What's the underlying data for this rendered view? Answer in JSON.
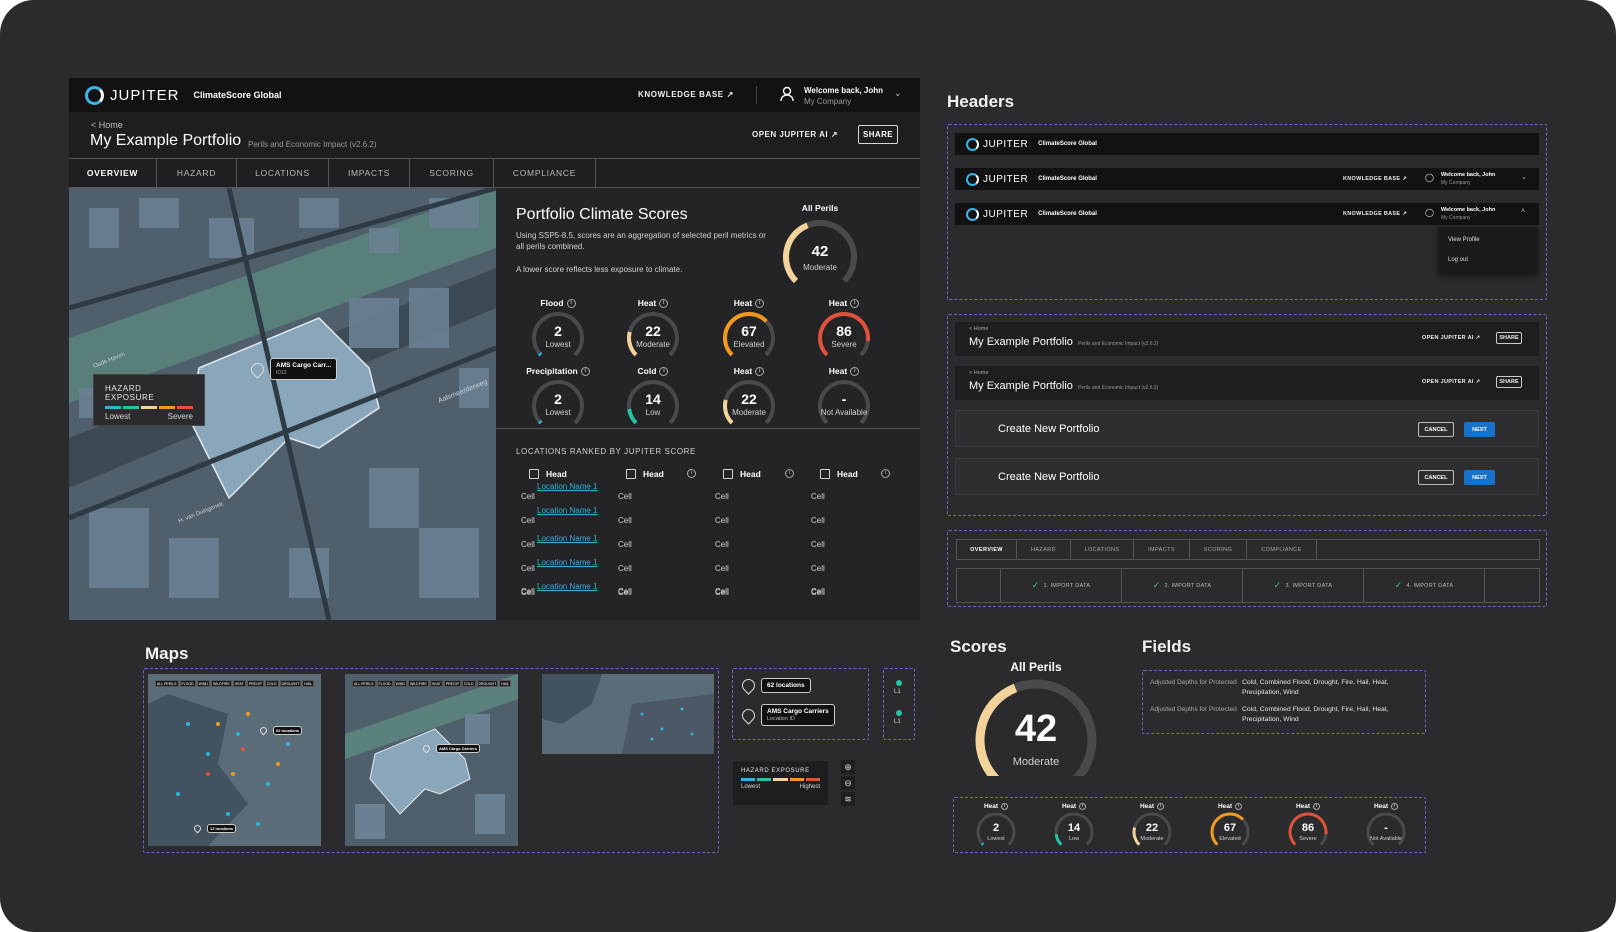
{
  "app": {
    "brand": "JUPITER",
    "product": "ClimateScore Global"
  },
  "header": {
    "knowledge_base": "KNOWLEDGE BASE",
    "welcome": "Welcome back, John",
    "company": "My Company"
  },
  "page": {
    "breadcrumb": "< Home",
    "title": "My Example Portfolio",
    "subtitle": "Perils and Economic Impact (v2.6.2)",
    "open_ai": "OPEN JUPITER AI",
    "share": "SHARE"
  },
  "tabs": [
    "OVERVIEW",
    "HAZARD",
    "LOCATIONS",
    "IMPACTS",
    "SCORING",
    "COMPLIANCE"
  ],
  "map": {
    "pin_label": "AMS Cargo Carr...",
    "pin_sub": "ID12",
    "legend_title": "HAZARD EXPOSURE",
    "legend_low": "Lowest",
    "legend_high": "Severe",
    "street1": "Aalsmeerderweg",
    "street2": "H. van Duingenstr.",
    "street3": "Oude Haven"
  },
  "portfolio": {
    "title": "Portfolio Climate Scores",
    "desc": "Using SSP5-8.5, scores are an aggregation of selected peril metrics or all perils combined.",
    "desc2": "A lower score reflects less exposure to climate.",
    "all_perils": {
      "peril": "All Perils",
      "value": "42",
      "label": "Moderate",
      "score": 42
    },
    "gauges": [
      {
        "peril": "Flood",
        "value": "2",
        "label": "Lowest",
        "score": 2,
        "color": "#2bb5d8"
      },
      {
        "peril": "Heat",
        "value": "22",
        "label": "Moderate",
        "score": 22,
        "color": "#f3d39a"
      },
      {
        "peril": "Heat",
        "value": "67",
        "label": "Elevated",
        "score": 67,
        "color": "#f19a1f"
      },
      {
        "peril": "Heat",
        "value": "86",
        "label": "Severe",
        "score": 86,
        "color": "#e0513a"
      },
      {
        "peril": "Precipitation",
        "value": "2",
        "label": "Lowest",
        "score": 2,
        "color": "#2bb5d8"
      },
      {
        "peril": "Cold",
        "value": "14",
        "label": "Low",
        "score": 14,
        "color": "#25c3a3"
      },
      {
        "peril": "Heat",
        "value": "22",
        "label": "Moderate",
        "score": 22,
        "color": "#f3d39a"
      },
      {
        "peril": "Heat",
        "value": "-",
        "label": "Not Available",
        "score": 0,
        "color": "#555555"
      }
    ]
  },
  "ranked": {
    "title": "LOCATIONS RANKED BY JUPITER SCORE",
    "heads": [
      "Head",
      "Head",
      "Head",
      "Head"
    ],
    "links": [
      "Location Name 1",
      "Location Name 1",
      "Location Name 1",
      "Location Name 1",
      "Location Name 1"
    ],
    "cell": "Cell"
  },
  "sections": {
    "headers": "Headers",
    "maps": "Maps",
    "scores": "Scores",
    "fields": "Fields"
  },
  "header_variants": {
    "view_profile": "View Profile",
    "log_out": "Log out"
  },
  "create": {
    "title": "Create New Portfolio",
    "cancel": "CANCEL",
    "next": "NEXT"
  },
  "steps": [
    "1. IMPORT DATA",
    "2. IMPORT DATA",
    "3. IMPORT DATA",
    "4. IMPORT DATA"
  ],
  "maps_panel": {
    "filters": [
      "ALL PERILS",
      "FLOOD",
      "WIND",
      "WILDFIRE",
      "HEAT",
      "PRECIP",
      "COLD",
      "DROUGHT",
      "HAIL"
    ],
    "locations": "62 locations",
    "locations2": "12 locations",
    "cargo": "AMS Cargo Carriers",
    "cargo_sub": "Location ID",
    "legend_title": "HAZARD EXPOSURE",
    "legend_low": "Lowest",
    "legend_high": "Highest",
    "layer": "L1"
  },
  "big_score": {
    "peril": "All Perils",
    "value": "42",
    "label": "Moderate",
    "score": 42
  },
  "small_gauges": [
    {
      "peril": "Heat",
      "value": "2",
      "label": "Lowest",
      "score": 2,
      "color": "#2bb5d8"
    },
    {
      "peril": "Heat",
      "value": "14",
      "label": "Low",
      "score": 14,
      "color": "#25c3a3"
    },
    {
      "peril": "Heat",
      "value": "22",
      "label": "Moderate",
      "score": 22,
      "color": "#f3d39a"
    },
    {
      "peril": "Heat",
      "value": "67",
      "label": "Elevated",
      "score": 67,
      "color": "#f19a1f"
    },
    {
      "peril": "Heat",
      "value": "86",
      "label": "Severe",
      "score": 86,
      "color": "#e0513a"
    },
    {
      "peril": "Heat",
      "value": "-",
      "label": "Not Available",
      "score": 0,
      "color": "#555555"
    }
  ],
  "fields": [
    {
      "label": "Adjusted Depths for Protected",
      "value": "Cold, Combined Flood, Drought, Fire, Hail, Heat, Precipitation, Wind"
    },
    {
      "label": "Adjusted Depths for Protected",
      "value": "Cold, Combined Flood, Drought, Fire, Hail, Heat, Precipitation, Wind"
    }
  ],
  "colors": {
    "accent": "#3ab3e6",
    "next": "#1673c9",
    "dash": "#7b5bc4",
    "link": "#2bb5d8"
  }
}
